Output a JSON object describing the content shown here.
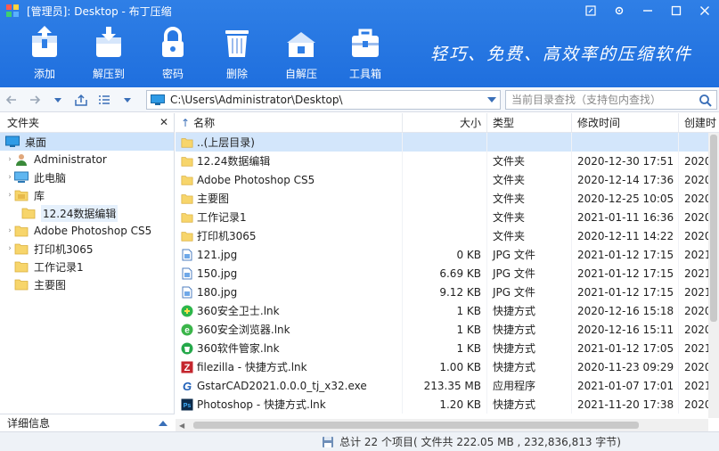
{
  "window": {
    "title": "[管理员]: Desktop - 布丁压缩"
  },
  "toolbar": [
    {
      "label": "添加",
      "icon": "add-archive-icon"
    },
    {
      "label": "解压到",
      "icon": "extract-icon"
    },
    {
      "label": "密码",
      "icon": "lock-icon"
    },
    {
      "label": "删除",
      "icon": "trash-icon"
    },
    {
      "label": "自解压",
      "icon": "self-extract-icon"
    },
    {
      "label": "工具箱",
      "icon": "toolbox-icon"
    }
  ],
  "slogan": "轻巧、免费、高效率的压缩软件",
  "address": {
    "path": "C:\\Users\\Administrator\\Desktop\\",
    "search_placeholder": "当前目录查找（支持包内查找）"
  },
  "left_panel": {
    "header": "文件夹",
    "tree": [
      {
        "label": "桌面",
        "icon": "desktop-icon",
        "indent": 0,
        "arrow": "",
        "selected": true
      },
      {
        "label": "Administrator",
        "icon": "user-icon",
        "indent": 1,
        "arrow": "›",
        "selected": false
      },
      {
        "label": "此电脑",
        "icon": "computer-icon",
        "indent": 1,
        "arrow": "›",
        "selected": false
      },
      {
        "label": "库",
        "icon": "library-folder-icon",
        "indent": 1,
        "arrow": "›",
        "selected": false
      },
      {
        "label": "12.24数据编辑",
        "icon": "folder-icon",
        "indent": 1,
        "arrow": "",
        "selected": false,
        "hover": true
      },
      {
        "label": "Adobe Photoshop CS5",
        "icon": "folder-icon",
        "indent": 1,
        "arrow": "›",
        "selected": false
      },
      {
        "label": "打印机3065",
        "icon": "folder-icon",
        "indent": 1,
        "arrow": "›",
        "selected": false
      },
      {
        "label": "工作记录1",
        "icon": "folder-icon",
        "indent": 1,
        "arrow": "",
        "selected": false
      },
      {
        "label": "主要图",
        "icon": "folder-icon",
        "indent": 1,
        "arrow": "",
        "selected": false
      }
    ],
    "detail_label": "详细信息"
  },
  "file_list": {
    "columns": {
      "name": "名称",
      "size": "大小",
      "type": "类型",
      "modified": "修改时间",
      "created": "创建时"
    },
    "rows": [
      {
        "name": "..(上层目录)",
        "size": "",
        "type": "",
        "modified": "",
        "created": "",
        "icon": "folder-icon",
        "selected": true
      },
      {
        "name": "12.24数据编辑",
        "size": "",
        "type": "文件夹",
        "modified": "2020-12-30 17:51",
        "created": "2020",
        "icon": "folder-icon"
      },
      {
        "name": "Adobe Photoshop CS5",
        "size": "",
        "type": "文件夹",
        "modified": "2020-12-14 17:36",
        "created": "2020",
        "icon": "folder-icon"
      },
      {
        "name": "主要图",
        "size": "",
        "type": "文件夹",
        "modified": "2020-12-25 10:05",
        "created": "2020",
        "icon": "folder-icon"
      },
      {
        "name": "工作记录1",
        "size": "",
        "type": "文件夹",
        "modified": "2021-01-11 16:36",
        "created": "2020",
        "icon": "folder-icon"
      },
      {
        "name": "打印机3065",
        "size": "",
        "type": "文件夹",
        "modified": "2020-12-11 14:22",
        "created": "2020",
        "icon": "folder-icon"
      },
      {
        "name": "121.jpg",
        "size": "0 KB",
        "type": "JPG 文件",
        "modified": "2021-01-12 17:15",
        "created": "2021",
        "icon": "image-file-icon"
      },
      {
        "name": "150.jpg",
        "size": "6.69 KB",
        "type": "JPG 文件",
        "modified": "2021-01-12 17:15",
        "created": "2021",
        "icon": "image-file-icon"
      },
      {
        "name": "180.jpg",
        "size": "9.12 KB",
        "type": "JPG 文件",
        "modified": "2021-01-12 17:15",
        "created": "2021",
        "icon": "image-file-icon"
      },
      {
        "name": "360安全卫士.lnk",
        "size": "1 KB",
        "type": "快捷方式",
        "modified": "2020-12-16 15:18",
        "created": "2020",
        "icon": "360-safe-icon"
      },
      {
        "name": "360安全浏览器.lnk",
        "size": "1 KB",
        "type": "快捷方式",
        "modified": "2020-12-16 15:11",
        "created": "2020",
        "icon": "360-browser-icon"
      },
      {
        "name": "360软件管家.lnk",
        "size": "1 KB",
        "type": "快捷方式",
        "modified": "2021-01-12 17:05",
        "created": "2021",
        "icon": "360-software-icon"
      },
      {
        "name": "filezilla - 快捷方式.lnk",
        "size": "1.00 KB",
        "type": "快捷方式",
        "modified": "2020-11-23 09:29",
        "created": "2020",
        "icon": "filezilla-icon"
      },
      {
        "name": "GstarCAD2021.0.0.0_tj_x32.exe",
        "size": "213.35 MB",
        "type": "应用程序",
        "modified": "2021-01-07 17:01",
        "created": "2021",
        "icon": "gstarcad-icon"
      },
      {
        "name": "Photoshop - 快捷方式.lnk",
        "size": "1.20 KB",
        "type": "快捷方式",
        "modified": "2021-11-20 17:38",
        "created": "2020",
        "icon": "photoshop-icon"
      }
    ]
  },
  "status": {
    "text": "总计 22 个项目( 文件共 222.05 MB , 232,836,813 字节)"
  },
  "colors": {
    "toolbar_blue": "#2777e3",
    "selection": "#cde3fb",
    "folder_yellow": "#f7d56b"
  }
}
